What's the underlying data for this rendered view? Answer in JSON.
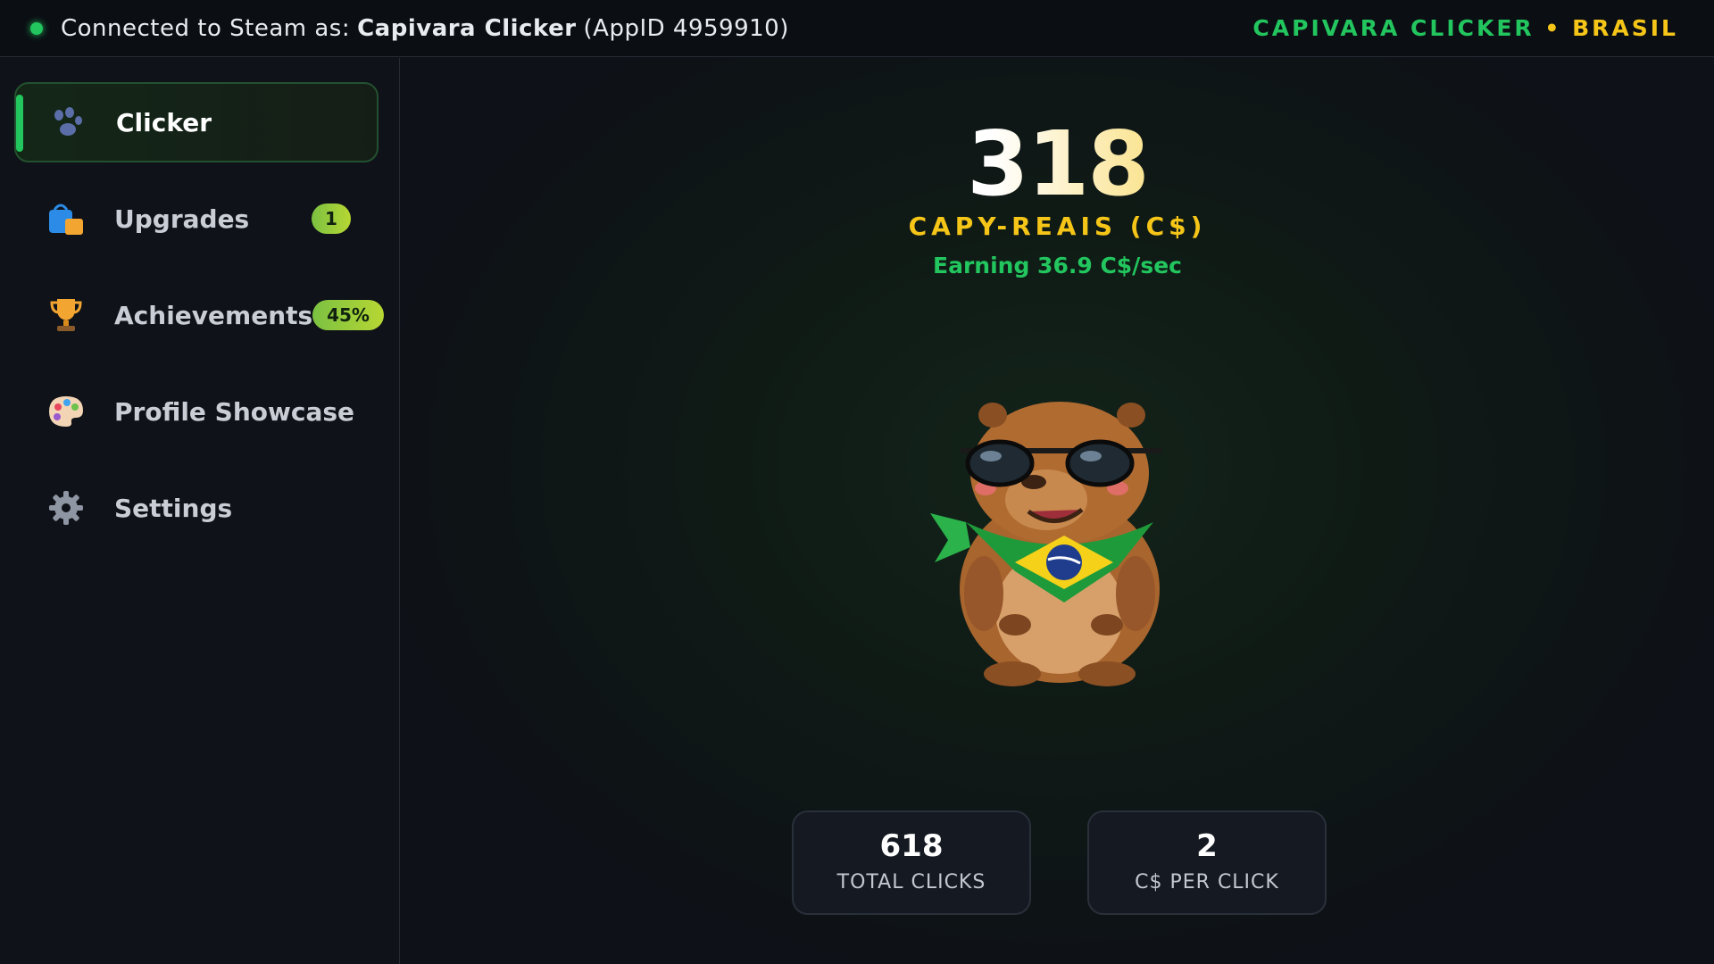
{
  "topbar": {
    "connected_prefix": "Connected to Steam as:",
    "account_name": "Capivara Clicker",
    "app_id": "(AppID 4959910)",
    "brand_left": "CAPIVARA CLICKER",
    "brand_sep": "•",
    "brand_right": "BRASIL"
  },
  "sidebar": {
    "items": [
      {
        "label": "Clicker",
        "icon": "paw-icon",
        "active": true
      },
      {
        "label": "Upgrades",
        "icon": "shopping-bag-icon",
        "badge": "1"
      },
      {
        "label": "Achievements",
        "icon": "trophy-icon",
        "badge": "45%"
      },
      {
        "label": "Profile Showcase",
        "icon": "palette-icon"
      },
      {
        "label": "Settings",
        "icon": "gear-icon"
      }
    ]
  },
  "main": {
    "balance": "318",
    "currency_label": "CAPY-REAIS (C$)",
    "earning_rate": "Earning 36.9 C$/sec",
    "stats": [
      {
        "value": "618",
        "label": "TOTAL CLICKS"
      },
      {
        "value": "2",
        "label": "C$ PER CLICK"
      }
    ]
  },
  "colors": {
    "accent_green": "#22c55e",
    "accent_gold": "#f5c518",
    "background": "#0e1117"
  }
}
